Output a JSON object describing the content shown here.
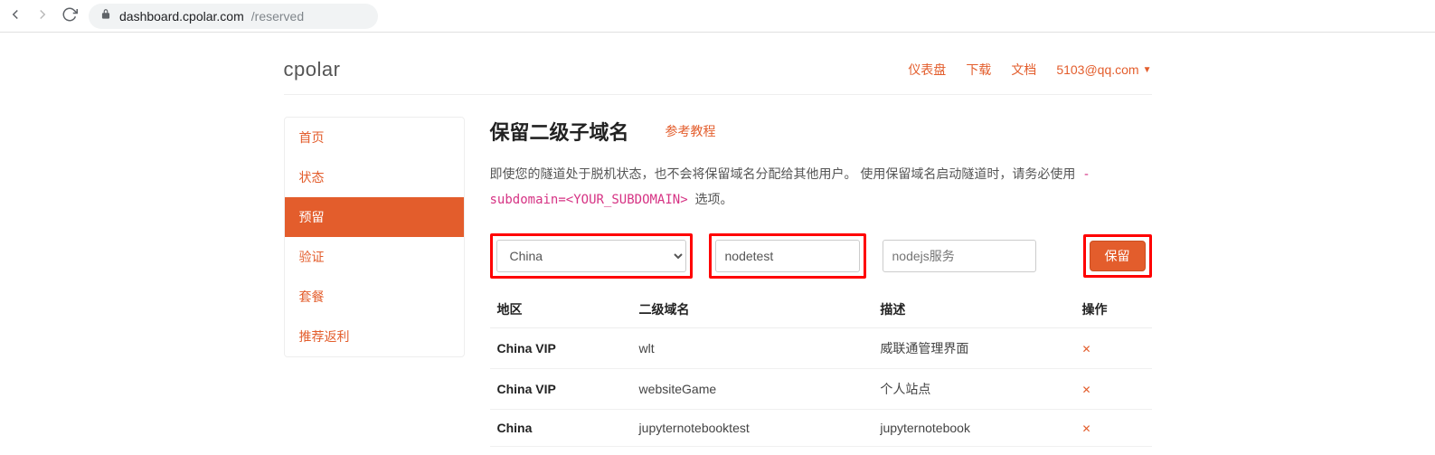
{
  "browser": {
    "url_host": "dashboard.cpolar.com",
    "url_path": "/reserved"
  },
  "header": {
    "logo": "cpolar",
    "nav": {
      "dashboard": "仪表盘",
      "download": "下载",
      "docs": "文档",
      "user": "5103@qq.com"
    }
  },
  "sidebar": {
    "items": [
      {
        "label": "首页"
      },
      {
        "label": "状态"
      },
      {
        "label": "预留",
        "active": true
      },
      {
        "label": "验证"
      },
      {
        "label": "套餐"
      },
      {
        "label": "推荐返利"
      }
    ]
  },
  "main": {
    "title": "保留二级子域名",
    "tutorial_link": "参考教程",
    "desc_part1": "即使您的隧道处于脱机状态，也不会将保留域名分配给其他用户。 使用保留域名启动隧道时，请务必使用 ",
    "desc_code": "-subdomain=<YOUR_SUBDOMAIN>",
    "desc_part2": " 选项。",
    "form": {
      "region_selected": "China",
      "name_value": "nodetest",
      "desc_value": "",
      "desc_placeholder": "nodejs服务",
      "submit_label": "保留"
    },
    "table": {
      "headers": {
        "region": "地区",
        "subdomain": "二级域名",
        "desc": "描述",
        "action": "操作"
      },
      "rows": [
        {
          "region": "China VIP",
          "subdomain": "wlt",
          "desc": "威联通管理界面"
        },
        {
          "region": "China VIP",
          "subdomain": "websiteGame",
          "desc": "个人站点"
        },
        {
          "region": "China",
          "subdomain": "jupyternotebooktest",
          "desc": "jupyternotebook"
        }
      ]
    }
  }
}
